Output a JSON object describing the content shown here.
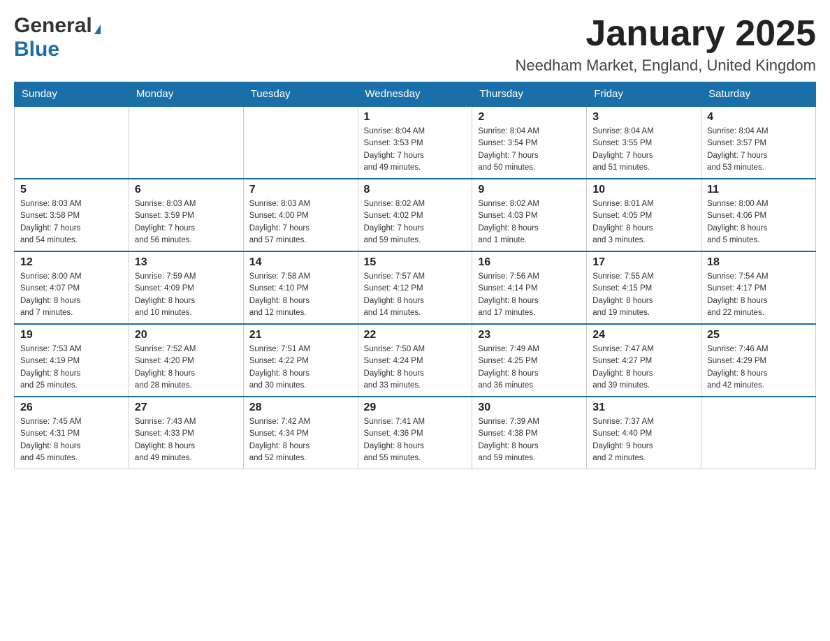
{
  "header": {
    "logo_general": "General",
    "logo_blue": "Blue",
    "month_title": "January 2025",
    "location": "Needham Market, England, United Kingdom"
  },
  "weekdays": [
    "Sunday",
    "Monday",
    "Tuesday",
    "Wednesday",
    "Thursday",
    "Friday",
    "Saturday"
  ],
  "weeks": [
    [
      {
        "day": "",
        "info": ""
      },
      {
        "day": "",
        "info": ""
      },
      {
        "day": "",
        "info": ""
      },
      {
        "day": "1",
        "info": "Sunrise: 8:04 AM\nSunset: 3:53 PM\nDaylight: 7 hours\nand 49 minutes."
      },
      {
        "day": "2",
        "info": "Sunrise: 8:04 AM\nSunset: 3:54 PM\nDaylight: 7 hours\nand 50 minutes."
      },
      {
        "day": "3",
        "info": "Sunrise: 8:04 AM\nSunset: 3:55 PM\nDaylight: 7 hours\nand 51 minutes."
      },
      {
        "day": "4",
        "info": "Sunrise: 8:04 AM\nSunset: 3:57 PM\nDaylight: 7 hours\nand 53 minutes."
      }
    ],
    [
      {
        "day": "5",
        "info": "Sunrise: 8:03 AM\nSunset: 3:58 PM\nDaylight: 7 hours\nand 54 minutes."
      },
      {
        "day": "6",
        "info": "Sunrise: 8:03 AM\nSunset: 3:59 PM\nDaylight: 7 hours\nand 56 minutes."
      },
      {
        "day": "7",
        "info": "Sunrise: 8:03 AM\nSunset: 4:00 PM\nDaylight: 7 hours\nand 57 minutes."
      },
      {
        "day": "8",
        "info": "Sunrise: 8:02 AM\nSunset: 4:02 PM\nDaylight: 7 hours\nand 59 minutes."
      },
      {
        "day": "9",
        "info": "Sunrise: 8:02 AM\nSunset: 4:03 PM\nDaylight: 8 hours\nand 1 minute."
      },
      {
        "day": "10",
        "info": "Sunrise: 8:01 AM\nSunset: 4:05 PM\nDaylight: 8 hours\nand 3 minutes."
      },
      {
        "day": "11",
        "info": "Sunrise: 8:00 AM\nSunset: 4:06 PM\nDaylight: 8 hours\nand 5 minutes."
      }
    ],
    [
      {
        "day": "12",
        "info": "Sunrise: 8:00 AM\nSunset: 4:07 PM\nDaylight: 8 hours\nand 7 minutes."
      },
      {
        "day": "13",
        "info": "Sunrise: 7:59 AM\nSunset: 4:09 PM\nDaylight: 8 hours\nand 10 minutes."
      },
      {
        "day": "14",
        "info": "Sunrise: 7:58 AM\nSunset: 4:10 PM\nDaylight: 8 hours\nand 12 minutes."
      },
      {
        "day": "15",
        "info": "Sunrise: 7:57 AM\nSunset: 4:12 PM\nDaylight: 8 hours\nand 14 minutes."
      },
      {
        "day": "16",
        "info": "Sunrise: 7:56 AM\nSunset: 4:14 PM\nDaylight: 8 hours\nand 17 minutes."
      },
      {
        "day": "17",
        "info": "Sunrise: 7:55 AM\nSunset: 4:15 PM\nDaylight: 8 hours\nand 19 minutes."
      },
      {
        "day": "18",
        "info": "Sunrise: 7:54 AM\nSunset: 4:17 PM\nDaylight: 8 hours\nand 22 minutes."
      }
    ],
    [
      {
        "day": "19",
        "info": "Sunrise: 7:53 AM\nSunset: 4:19 PM\nDaylight: 8 hours\nand 25 minutes."
      },
      {
        "day": "20",
        "info": "Sunrise: 7:52 AM\nSunset: 4:20 PM\nDaylight: 8 hours\nand 28 minutes."
      },
      {
        "day": "21",
        "info": "Sunrise: 7:51 AM\nSunset: 4:22 PM\nDaylight: 8 hours\nand 30 minutes."
      },
      {
        "day": "22",
        "info": "Sunrise: 7:50 AM\nSunset: 4:24 PM\nDaylight: 8 hours\nand 33 minutes."
      },
      {
        "day": "23",
        "info": "Sunrise: 7:49 AM\nSunset: 4:25 PM\nDaylight: 8 hours\nand 36 minutes."
      },
      {
        "day": "24",
        "info": "Sunrise: 7:47 AM\nSunset: 4:27 PM\nDaylight: 8 hours\nand 39 minutes."
      },
      {
        "day": "25",
        "info": "Sunrise: 7:46 AM\nSunset: 4:29 PM\nDaylight: 8 hours\nand 42 minutes."
      }
    ],
    [
      {
        "day": "26",
        "info": "Sunrise: 7:45 AM\nSunset: 4:31 PM\nDaylight: 8 hours\nand 45 minutes."
      },
      {
        "day": "27",
        "info": "Sunrise: 7:43 AM\nSunset: 4:33 PM\nDaylight: 8 hours\nand 49 minutes."
      },
      {
        "day": "28",
        "info": "Sunrise: 7:42 AM\nSunset: 4:34 PM\nDaylight: 8 hours\nand 52 minutes."
      },
      {
        "day": "29",
        "info": "Sunrise: 7:41 AM\nSunset: 4:36 PM\nDaylight: 8 hours\nand 55 minutes."
      },
      {
        "day": "30",
        "info": "Sunrise: 7:39 AM\nSunset: 4:38 PM\nDaylight: 8 hours\nand 59 minutes."
      },
      {
        "day": "31",
        "info": "Sunrise: 7:37 AM\nSunset: 4:40 PM\nDaylight: 9 hours\nand 2 minutes."
      },
      {
        "day": "",
        "info": ""
      }
    ]
  ]
}
